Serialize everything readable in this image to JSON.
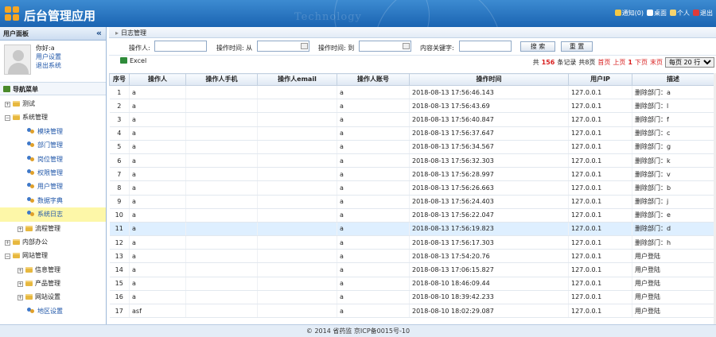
{
  "header": {
    "title": "后台管理应用",
    "watermark": "Technology",
    "links": [
      {
        "label": "通知(0)",
        "icon": "bell-icon",
        "color": "#f3c744"
      },
      {
        "label": "桌面",
        "icon": "home-icon",
        "color": "#ffffff"
      },
      {
        "label": "个人",
        "icon": "person-icon",
        "color": "#f6d36d"
      },
      {
        "label": "退出",
        "icon": "power-icon",
        "color": "#e03a3a"
      }
    ]
  },
  "sidebar": {
    "panel_title": "用户面板",
    "collapse_icon": "«",
    "user": {
      "greeting": "你好:a",
      "settings": "用户设置",
      "logout": "退出系统"
    },
    "nav_title": "导航菜单",
    "tree": [
      {
        "label": "测试",
        "level": 0,
        "type": "folder",
        "toggle": "+"
      },
      {
        "label": "系统管理",
        "level": 0,
        "type": "folder",
        "toggle": "−"
      },
      {
        "label": "模块管理",
        "level": 1,
        "type": "leaf"
      },
      {
        "label": "部门管理",
        "level": 1,
        "type": "leaf"
      },
      {
        "label": "岗位管理",
        "level": 1,
        "type": "leaf"
      },
      {
        "label": "权限管理",
        "level": 1,
        "type": "leaf"
      },
      {
        "label": "用户管理",
        "level": 1,
        "type": "leaf"
      },
      {
        "label": "数据字典",
        "level": 1,
        "type": "leaf"
      },
      {
        "label": "系统日志",
        "level": 1,
        "type": "leaf",
        "selected": true
      },
      {
        "label": "流程管理",
        "level": 1,
        "type": "folder",
        "toggle": "+"
      },
      {
        "label": "内部办公",
        "level": 0,
        "type": "folder",
        "toggle": "+"
      },
      {
        "label": "网站管理",
        "level": 0,
        "type": "folder",
        "toggle": "−"
      },
      {
        "label": "信息管理",
        "level": 1,
        "type": "folder",
        "toggle": "+"
      },
      {
        "label": "产品管理",
        "level": 1,
        "type": "folder",
        "toggle": "+"
      },
      {
        "label": "网站设置",
        "level": 1,
        "type": "folder",
        "toggle": "+"
      },
      {
        "label": "地区设置",
        "level": 1,
        "type": "leaf"
      }
    ]
  },
  "main": {
    "tab_title": "日志管理",
    "filters": {
      "operator_label": "操作人:",
      "time_from_label": "操作时间: 从",
      "time_to_label": "操作时间: 到",
      "keyword_label": "内容关键字:",
      "search_button": "搜 索",
      "reset_button": "重 置"
    },
    "toolbar": {
      "excel_label": "Excel",
      "total_prefix": "共",
      "total_count": "156",
      "total_suffix": "条记录",
      "pages": "共8页",
      "first": "首页",
      "prev": "上页",
      "current": "1",
      "next": "下页",
      "last": "末页",
      "page_size": "每页 20 行"
    },
    "columns": [
      "序号",
      "操作人",
      "操作人手机",
      "操作人email",
      "操作人账号",
      "操作时间",
      "用户IP",
      "描述"
    ],
    "rows": [
      [
        "1",
        "a",
        "",
        "",
        "a",
        "2018-08-13 17:56:46.143",
        "127.0.0.1",
        "删除部门：a"
      ],
      [
        "2",
        "a",
        "",
        "",
        "a",
        "2018-08-13 17:56:43.69",
        "127.0.0.1",
        "删除部门：l"
      ],
      [
        "3",
        "a",
        "",
        "",
        "a",
        "2018-08-13 17:56:40.847",
        "127.0.0.1",
        "删除部门：f"
      ],
      [
        "4",
        "a",
        "",
        "",
        "a",
        "2018-08-13 17:56:37.647",
        "127.0.0.1",
        "删除部门：c"
      ],
      [
        "5",
        "a",
        "",
        "",
        "a",
        "2018-08-13 17:56:34.567",
        "127.0.0.1",
        "删除部门：g"
      ],
      [
        "6",
        "a",
        "",
        "",
        "a",
        "2018-08-13 17:56:32.303",
        "127.0.0.1",
        "删除部门：k"
      ],
      [
        "7",
        "a",
        "",
        "",
        "a",
        "2018-08-13 17:56:28.997",
        "127.0.0.1",
        "删除部门：v"
      ],
      [
        "8",
        "a",
        "",
        "",
        "a",
        "2018-08-13 17:56:26.663",
        "127.0.0.1",
        "删除部门：b"
      ],
      [
        "9",
        "a",
        "",
        "",
        "a",
        "2018-08-13 17:56:24.403",
        "127.0.0.1",
        "删除部门：j"
      ],
      [
        "10",
        "a",
        "",
        "",
        "a",
        "2018-08-13 17:56:22.047",
        "127.0.0.1",
        "删除部门：e"
      ],
      [
        "11",
        "a",
        "",
        "",
        "a",
        "2018-08-13 17:56:19.823",
        "127.0.0.1",
        "删除部门：d"
      ],
      [
        "12",
        "a",
        "",
        "",
        "a",
        "2018-08-13 17:56:17.303",
        "127.0.0.1",
        "删除部门：h"
      ],
      [
        "13",
        "a",
        "",
        "",
        "a",
        "2018-08-13 17:54:20.76",
        "127.0.0.1",
        "用户登陆"
      ],
      [
        "14",
        "a",
        "",
        "",
        "a",
        "2018-08-13 17:06:15.827",
        "127.0.0.1",
        "用户登陆"
      ],
      [
        "15",
        "a",
        "",
        "",
        "a",
        "2018-08-10 18:46:09.44",
        "127.0.0.1",
        "用户登陆"
      ],
      [
        "16",
        "a",
        "",
        "",
        "a",
        "2018-08-10 18:39:42.233",
        "127.0.0.1",
        "用户登陆"
      ],
      [
        "17",
        "asf",
        "",
        "",
        "a",
        "2018-08-10 18:02:29.087",
        "127.0.0.1",
        "用户登陆"
      ]
    ],
    "highlighted_row": 10
  },
  "footer": {
    "text": "© 2014 省药监 京ICP备0015号-10"
  }
}
